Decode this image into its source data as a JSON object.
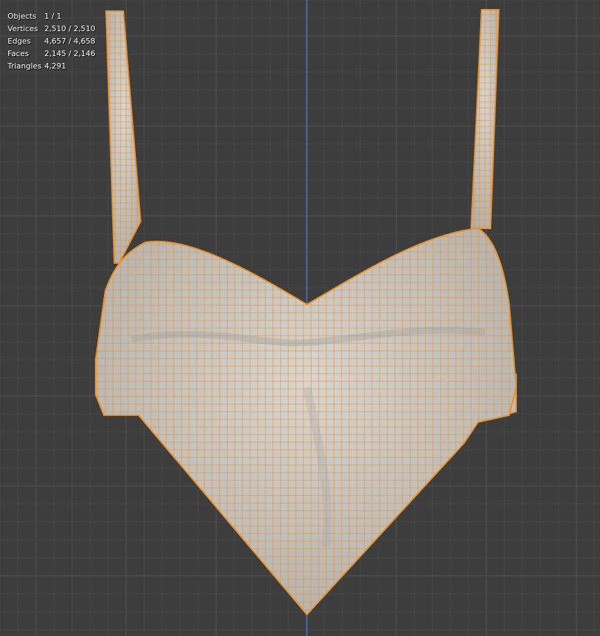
{
  "viewport": {
    "background": "#3d3d3d",
    "grid_minor": "#464646",
    "grid_major": "#555555",
    "axis_color": "#4a6fb5",
    "mesh_face": "#c8c6c3",
    "mesh_edge": "#e8912c"
  },
  "stats": [
    {
      "label": "Objects",
      "value": "1 / 1"
    },
    {
      "label": "Vertices",
      "value": "2,510 / 2,510"
    },
    {
      "label": "Edges",
      "value": "4,657 / 4,658"
    },
    {
      "label": "Faces",
      "value": "2,145 / 2,146"
    },
    {
      "label": "Triangles",
      "value": "4,291"
    }
  ]
}
